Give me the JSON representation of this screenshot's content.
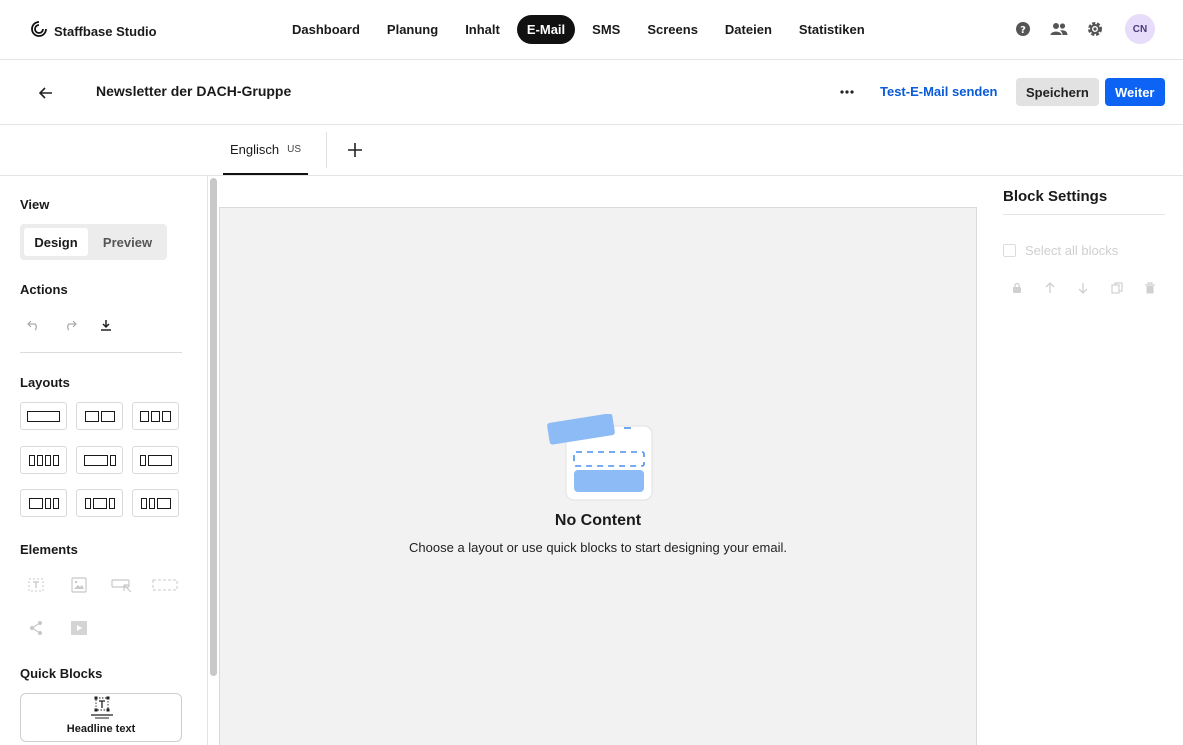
{
  "brand": {
    "name": "Staffbase Studio",
    "icon": "staffbase-logo-icon"
  },
  "nav": {
    "items": [
      {
        "label": "Dashboard",
        "active": false
      },
      {
        "label": "Planung",
        "active": false
      },
      {
        "label": "Inhalt",
        "active": false
      },
      {
        "label": "E-Mail",
        "active": true
      },
      {
        "label": "SMS",
        "active": false
      },
      {
        "label": "Screens",
        "active": false
      },
      {
        "label": "Dateien",
        "active": false
      },
      {
        "label": "Statistiken",
        "active": false
      }
    ],
    "icons": [
      "help-icon",
      "users-icon",
      "gear-icon"
    ],
    "avatar_initials": "CN"
  },
  "titlebar": {
    "title": "Newsletter der DACH-Gruppe",
    "test_email_label": "Test-E-Mail senden",
    "save_label": "Speichern",
    "next_label": "Weiter"
  },
  "languages": {
    "tabs": [
      {
        "name": "Englisch",
        "code": "US"
      }
    ]
  },
  "sidebar": {
    "view_label": "View",
    "view_options": [
      "Design",
      "Preview"
    ],
    "view_selected": "Design",
    "actions_label": "Actions",
    "actions": [
      "undo-icon",
      "redo-icon",
      "download-icon"
    ],
    "layouts_label": "Layouts",
    "elements_label": "Elements",
    "elements": [
      "text-element-icon",
      "image-element-icon",
      "button-element-icon",
      "spacer-element-icon",
      "social-element-icon",
      "video-element-icon"
    ],
    "quick_blocks_label": "Quick Blocks",
    "quick_blocks": [
      {
        "label": "Headline text"
      }
    ]
  },
  "canvas": {
    "empty_title": "No Content",
    "empty_description": "Choose a layout or use quick blocks to start designing your email."
  },
  "block_settings": {
    "title": "Block Settings",
    "select_all_label": "Select all blocks",
    "icons": [
      "lock-icon",
      "move-up-icon",
      "move-down-icon",
      "duplicate-icon",
      "delete-icon"
    ]
  },
  "colors": {
    "accent": "#0d63f3",
    "link": "#0a5bd8",
    "illustration": "#8dbbf5"
  }
}
